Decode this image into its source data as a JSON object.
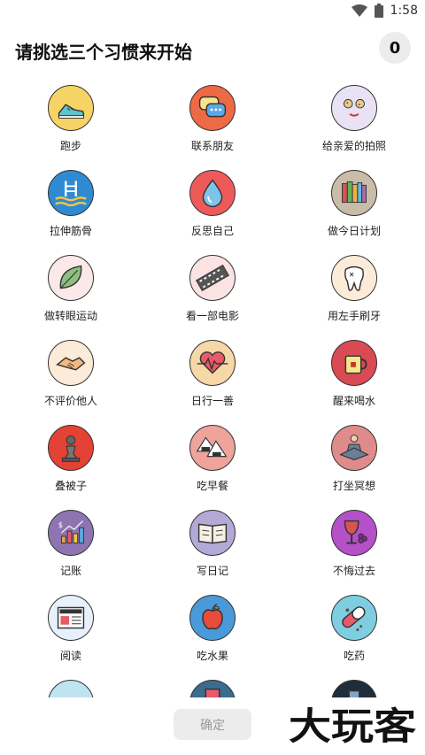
{
  "status_bar": {
    "time": "1:58"
  },
  "header": {
    "title": "请挑选三个习惯来开始",
    "selected_count": "0"
  },
  "habits": [
    {
      "label": "跑步",
      "icon": "sneaker-icon",
      "bg": "#f6d365"
    },
    {
      "label": "联系朋友",
      "icon": "chat-bubbles-icon",
      "bg": "#ee6a45"
    },
    {
      "label": "给亲爱的拍照",
      "icon": "cookie-face-icon",
      "bg": "#e8e2f4"
    },
    {
      "label": "拉伸筋骨",
      "icon": "pool-ladder-icon",
      "bg": "#2f8ad4"
    },
    {
      "label": "反思自己",
      "icon": "water-drop-icon",
      "bg": "#ee5a5a"
    },
    {
      "label": "做今日计划",
      "icon": "books-icon",
      "bg": "#c9bca8"
    },
    {
      "label": "做转眼运动",
      "icon": "leaf-icon",
      "bg": "#fbe8e8"
    },
    {
      "label": "看一部电影",
      "icon": "film-strip-icon",
      "bg": "#fbe3e3"
    },
    {
      "label": "用左手刷牙",
      "icon": "tooth-icon",
      "bg": "#fcebd8"
    },
    {
      "label": "不评价他人",
      "icon": "handshake-icon",
      "bg": "#fcebd8"
    },
    {
      "label": "日行一善",
      "icon": "heartbeat-icon",
      "bg": "#f6d7a8"
    },
    {
      "label": "醒来喝水",
      "icon": "mug-icon",
      "bg": "#d94a55"
    },
    {
      "label": "叠被子",
      "icon": "chess-pawn-icon",
      "bg": "#e34234"
    },
    {
      "label": "吃早餐",
      "icon": "rice-ball-icon",
      "bg": "#eea39b"
    },
    {
      "label": "打坐冥想",
      "icon": "meditation-icon",
      "bg": "#e08b8b"
    },
    {
      "label": "记账",
      "icon": "bar-chart-icon",
      "bg": "#8e75b2"
    },
    {
      "label": "写日记",
      "icon": "open-book-icon",
      "bg": "#b3a9d6"
    },
    {
      "label": "不悔过去",
      "icon": "wine-glass-icon",
      "bg": "#b550c9"
    },
    {
      "label": "阅读",
      "icon": "newspaper-icon",
      "bg": "#e8f0fb"
    },
    {
      "label": "吃水果",
      "icon": "apple-icon",
      "bg": "#4a9ad9"
    },
    {
      "label": "吃药",
      "icon": "pill-icon",
      "bg": "#7fcde0"
    },
    {
      "label": "",
      "icon": "partial-icon-a",
      "bg": "#bfe3f0"
    },
    {
      "label": "",
      "icon": "partial-icon-b",
      "bg": "#3a6c8c"
    },
    {
      "label": "",
      "icon": "partial-icon-c",
      "bg": "#1f2e3a"
    }
  ],
  "footer": {
    "confirm_label": "确定",
    "watermark": "大玩客"
  }
}
